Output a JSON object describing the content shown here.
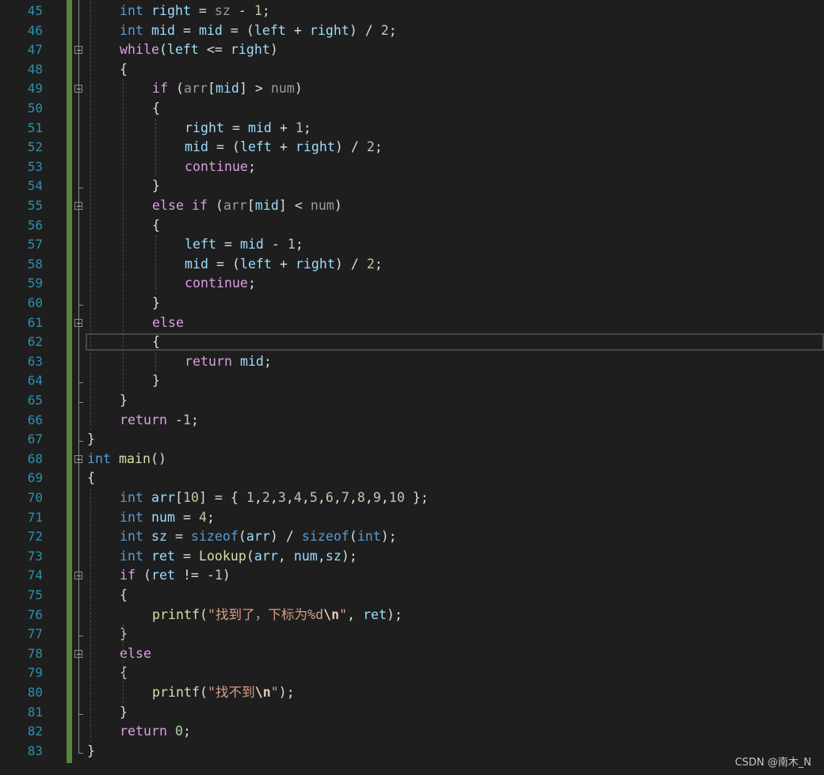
{
  "editor": {
    "lines": [
      {
        "n": "45",
        "t": [
          [
            "kw",
            "int"
          ],
          [
            "punc",
            " "
          ],
          [
            "var",
            "right"
          ],
          [
            "punc",
            " = "
          ],
          [
            "param",
            "sz"
          ],
          [
            "punc",
            " - "
          ],
          [
            "num",
            "1"
          ],
          [
            "punc",
            ";"
          ]
        ]
      },
      {
        "n": "46",
        "t": [
          [
            "kw",
            "int"
          ],
          [
            "punc",
            " "
          ],
          [
            "var",
            "mid"
          ],
          [
            "punc",
            " = "
          ],
          [
            "var",
            "mid"
          ],
          [
            "punc",
            " = ("
          ],
          [
            "var",
            "left"
          ],
          [
            "punc",
            " + "
          ],
          [
            "var",
            "right"
          ],
          [
            "punc",
            ") / "
          ],
          [
            "num",
            "2"
          ],
          [
            "punc",
            ";"
          ]
        ]
      },
      {
        "n": "47",
        "t": [
          [
            "ctl",
            "while"
          ],
          [
            "punc",
            "("
          ],
          [
            "var",
            "left"
          ],
          [
            "punc",
            " <= "
          ],
          [
            "var",
            "right"
          ],
          [
            "punc",
            ")"
          ]
        ]
      },
      {
        "n": "48",
        "t": [
          [
            "punc",
            "{"
          ]
        ]
      },
      {
        "n": "49",
        "t": [
          [
            "ctl",
            "if"
          ],
          [
            "punc",
            " ("
          ],
          [
            "param",
            "arr"
          ],
          [
            "punc",
            "["
          ],
          [
            "var",
            "mid"
          ],
          [
            "punc",
            "] > "
          ],
          [
            "param",
            "num"
          ],
          [
            "punc",
            ")"
          ]
        ]
      },
      {
        "n": "50",
        "t": [
          [
            "punc",
            "{"
          ]
        ]
      },
      {
        "n": "51",
        "t": [
          [
            "var",
            "right"
          ],
          [
            "punc",
            " = "
          ],
          [
            "var",
            "mid"
          ],
          [
            "punc",
            " + "
          ],
          [
            "num",
            "1"
          ],
          [
            "punc",
            ";"
          ]
        ]
      },
      {
        "n": "52",
        "t": [
          [
            "var",
            "mid"
          ],
          [
            "punc",
            " = ("
          ],
          [
            "var",
            "left"
          ],
          [
            "punc",
            " + "
          ],
          [
            "var",
            "right"
          ],
          [
            "punc",
            ") / "
          ],
          [
            "num",
            "2"
          ],
          [
            "punc",
            ";"
          ]
        ]
      },
      {
        "n": "53",
        "t": [
          [
            "ctl",
            "continue"
          ],
          [
            "punc",
            ";"
          ]
        ]
      },
      {
        "n": "54",
        "t": [
          [
            "punc",
            "}"
          ]
        ]
      },
      {
        "n": "55",
        "t": [
          [
            "ctl",
            "else"
          ],
          [
            "punc",
            " "
          ],
          [
            "ctl",
            "if"
          ],
          [
            "punc",
            " ("
          ],
          [
            "param",
            "arr"
          ],
          [
            "punc",
            "["
          ],
          [
            "var",
            "mid"
          ],
          [
            "punc",
            "] < "
          ],
          [
            "param",
            "num"
          ],
          [
            "punc",
            ")"
          ]
        ]
      },
      {
        "n": "56",
        "t": [
          [
            "punc",
            "{"
          ]
        ]
      },
      {
        "n": "57",
        "t": [
          [
            "var",
            "left"
          ],
          [
            "punc",
            " = "
          ],
          [
            "var",
            "mid"
          ],
          [
            "punc",
            " - "
          ],
          [
            "num",
            "1"
          ],
          [
            "punc",
            ";"
          ]
        ]
      },
      {
        "n": "58",
        "t": [
          [
            "var",
            "mid"
          ],
          [
            "punc",
            " = ("
          ],
          [
            "var",
            "left"
          ],
          [
            "punc",
            " + "
          ],
          [
            "var",
            "right"
          ],
          [
            "punc",
            ") / "
          ],
          [
            "num",
            "2"
          ],
          [
            "punc",
            ";"
          ]
        ]
      },
      {
        "n": "59",
        "t": [
          [
            "ctl",
            "continue"
          ],
          [
            "punc",
            ";"
          ]
        ]
      },
      {
        "n": "60",
        "t": [
          [
            "punc",
            "}"
          ]
        ]
      },
      {
        "n": "61",
        "t": [
          [
            "ctl",
            "else"
          ]
        ]
      },
      {
        "n": "62",
        "t": [
          [
            "punc",
            "{"
          ]
        ]
      },
      {
        "n": "63",
        "t": [
          [
            "ctl",
            "return"
          ],
          [
            "punc",
            " "
          ],
          [
            "var",
            "mid"
          ],
          [
            "punc",
            ";"
          ]
        ]
      },
      {
        "n": "64",
        "t": [
          [
            "punc",
            "}"
          ]
        ]
      },
      {
        "n": "65",
        "t": [
          [
            "punc",
            "}"
          ]
        ]
      },
      {
        "n": "66",
        "t": [
          [
            "ctl",
            "return"
          ],
          [
            "punc",
            " -"
          ],
          [
            "num",
            "1"
          ],
          [
            "punc",
            ";"
          ]
        ]
      },
      {
        "n": "67",
        "t": [
          [
            "punc",
            "}"
          ]
        ]
      },
      {
        "n": "68",
        "t": [
          [
            "kw",
            "int"
          ],
          [
            "punc",
            " "
          ],
          [
            "fn",
            "main"
          ],
          [
            "punc",
            "()"
          ]
        ]
      },
      {
        "n": "69",
        "t": [
          [
            "punc",
            "{"
          ]
        ]
      },
      {
        "n": "70",
        "t": [
          [
            "kw",
            "int"
          ],
          [
            "punc",
            " "
          ],
          [
            "var",
            "arr"
          ],
          [
            "punc",
            "["
          ],
          [
            "num",
            "10"
          ],
          [
            "punc",
            "] = { "
          ],
          [
            "num",
            "1"
          ],
          [
            "punc",
            ","
          ],
          [
            "num",
            "2"
          ],
          [
            "punc",
            ","
          ],
          [
            "num",
            "3"
          ],
          [
            "punc",
            ","
          ],
          [
            "num",
            "4"
          ],
          [
            "punc",
            ","
          ],
          [
            "num",
            "5"
          ],
          [
            "punc",
            ","
          ],
          [
            "num",
            "6"
          ],
          [
            "punc",
            ","
          ],
          [
            "num",
            "7"
          ],
          [
            "punc",
            ","
          ],
          [
            "num",
            "8"
          ],
          [
            "punc",
            ","
          ],
          [
            "num",
            "9"
          ],
          [
            "punc",
            ","
          ],
          [
            "num",
            "10"
          ],
          [
            "punc",
            " };"
          ]
        ]
      },
      {
        "n": "71",
        "t": [
          [
            "kw",
            "int"
          ],
          [
            "punc",
            " "
          ],
          [
            "var",
            "num"
          ],
          [
            "punc",
            " = "
          ],
          [
            "num",
            "4"
          ],
          [
            "punc",
            ";"
          ]
        ]
      },
      {
        "n": "72",
        "t": [
          [
            "kw",
            "int"
          ],
          [
            "punc",
            " "
          ],
          [
            "var",
            "sz"
          ],
          [
            "punc",
            " = "
          ],
          [
            "kw",
            "sizeof"
          ],
          [
            "punc",
            "("
          ],
          [
            "var",
            "arr"
          ],
          [
            "punc",
            ") / "
          ],
          [
            "kw",
            "sizeof"
          ],
          [
            "punc",
            "("
          ],
          [
            "kw",
            "int"
          ],
          [
            "punc",
            ");"
          ]
        ]
      },
      {
        "n": "73",
        "t": [
          [
            "kw",
            "int"
          ],
          [
            "punc",
            " "
          ],
          [
            "var",
            "ret"
          ],
          [
            "punc",
            " = "
          ],
          [
            "fn",
            "Lookup"
          ],
          [
            "punc",
            "("
          ],
          [
            "var",
            "arr"
          ],
          [
            "punc",
            ", "
          ],
          [
            "var",
            "num"
          ],
          [
            "punc",
            ","
          ],
          [
            "var",
            "sz"
          ],
          [
            "punc",
            ");"
          ]
        ]
      },
      {
        "n": "74",
        "t": [
          [
            "ctl",
            "if"
          ],
          [
            "punc",
            " ("
          ],
          [
            "var",
            "ret"
          ],
          [
            "punc",
            " != -"
          ],
          [
            "num",
            "1"
          ],
          [
            "punc",
            ")"
          ]
        ]
      },
      {
        "n": "75",
        "t": [
          [
            "punc",
            "{"
          ]
        ]
      },
      {
        "n": "76",
        "t": [
          [
            "fn",
            "printf"
          ],
          [
            "punc",
            "("
          ],
          [
            "str",
            "\"找到了，下标为%d"
          ],
          [
            "esc",
            "\\n"
          ],
          [
            "str",
            "\""
          ],
          [
            "punc",
            ", "
          ],
          [
            "var",
            "ret"
          ],
          [
            "punc",
            ");"
          ]
        ]
      },
      {
        "n": "77",
        "t": [
          [
            "punc",
            "}"
          ]
        ]
      },
      {
        "n": "78",
        "t": [
          [
            "ctl",
            "else"
          ]
        ]
      },
      {
        "n": "79",
        "t": [
          [
            "punc",
            "{"
          ]
        ]
      },
      {
        "n": "80",
        "t": [
          [
            "fn",
            "printf"
          ],
          [
            "punc",
            "("
          ],
          [
            "str",
            "\"找不到"
          ],
          [
            "esc",
            "\\n"
          ],
          [
            "str",
            "\""
          ],
          [
            "punc",
            ");"
          ]
        ]
      },
      {
        "n": "81",
        "t": [
          [
            "punc",
            "}"
          ]
        ]
      },
      {
        "n": "82",
        "t": [
          [
            "ctl",
            "return"
          ],
          [
            "punc",
            " "
          ],
          [
            "num",
            "0"
          ],
          [
            "punc",
            ";"
          ]
        ]
      },
      {
        "n": "83",
        "t": [
          [
            "punc",
            "}"
          ]
        ]
      }
    ]
  },
  "watermark": "CSDN @南木_N"
}
